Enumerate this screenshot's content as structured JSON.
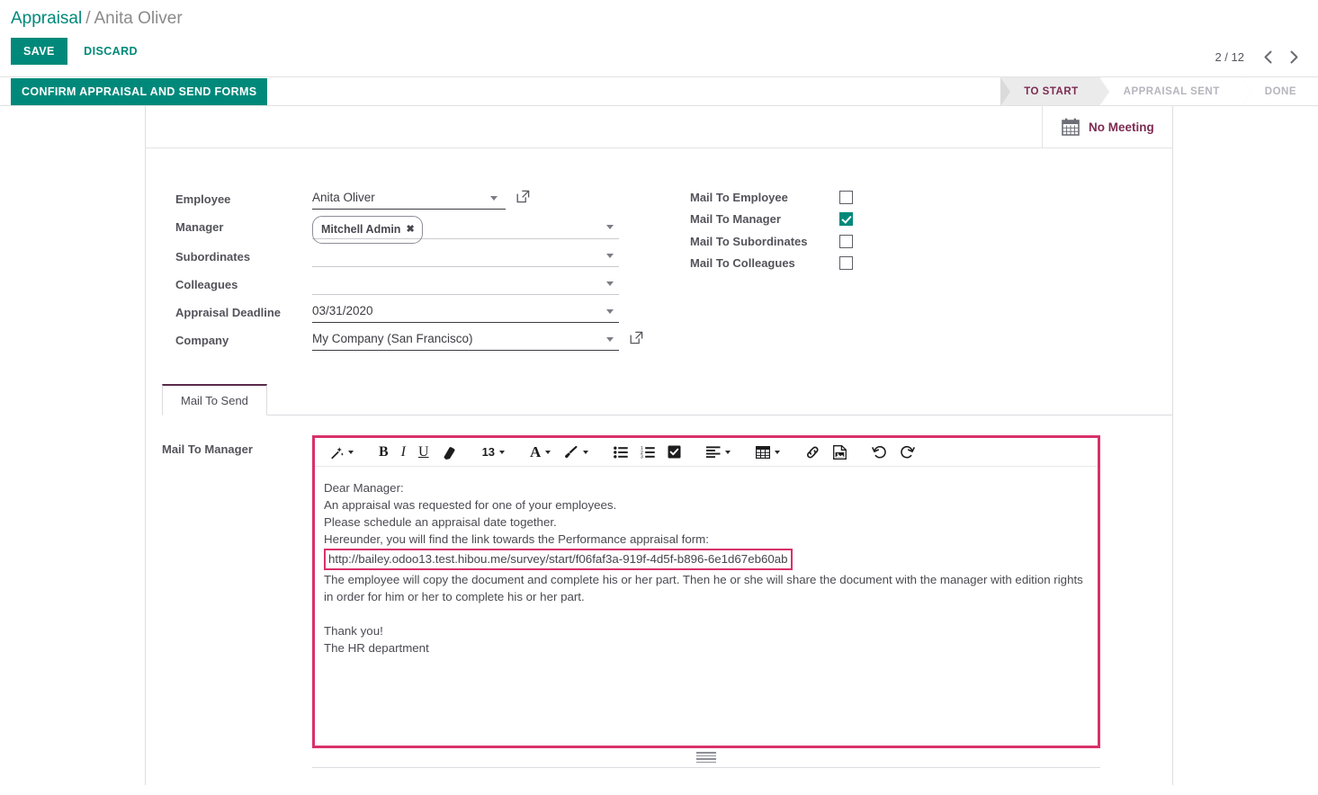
{
  "breadcrumb": {
    "root": "Appraisal",
    "separator": "/",
    "current": "Anita Oliver"
  },
  "actions": {
    "save_label": "SAVE",
    "discard_label": "DISCARD",
    "confirm_label": "CONFIRM APPRAISAL AND SEND FORMS"
  },
  "pager": {
    "count": "2 / 12",
    "prev_icon": "chevron-left-icon",
    "next_icon": "chevron-right-icon"
  },
  "statusbar": {
    "stages": [
      {
        "label": "TO START",
        "active": true
      },
      {
        "label": "APPRAISAL SENT",
        "active": false
      },
      {
        "label": "DONE",
        "active": false
      }
    ],
    "active_color": "#7c2b52",
    "inactive_color": "#b6b5bd"
  },
  "buttonbox": {
    "meeting_label": "No Meeting",
    "meeting_icon": "calendar-icon"
  },
  "form": {
    "fields": [
      {
        "label": "Employee",
        "value": "Anita Oliver",
        "type": "many2one",
        "has_extlink": true,
        "underline": "strong"
      },
      {
        "label": "Manager",
        "value": "",
        "type": "tags",
        "tags": [
          "Mitchell Admin"
        ],
        "has_extlink": false,
        "underline": "light"
      },
      {
        "label": "Subordinates",
        "value": "",
        "type": "tags",
        "tags": [],
        "has_extlink": false,
        "underline": "light"
      },
      {
        "label": "Colleagues",
        "value": "",
        "type": "tags",
        "tags": [],
        "has_extlink": false,
        "underline": "light"
      },
      {
        "label": "Appraisal Deadline",
        "value": "03/31/2020",
        "type": "date",
        "has_extlink": false,
        "underline": "strong"
      },
      {
        "label": "Company",
        "value": "My Company (San Francisco)",
        "type": "many2one",
        "has_extlink": true,
        "underline": "strong"
      }
    ],
    "checkboxes": [
      {
        "label": "Mail To Employee",
        "checked": false
      },
      {
        "label": "Mail To Manager",
        "checked": true
      },
      {
        "label": "Mail To Subordinates",
        "checked": false
      },
      {
        "label": "Mail To Colleagues",
        "checked": false
      }
    ],
    "checkbox_on_color": "#00897a"
  },
  "notebook": {
    "tabs": [
      {
        "label": "Mail To Send",
        "active": true
      }
    ]
  },
  "editor": {
    "field_label": "Mail To Manager",
    "highlight_color": "#d8326a",
    "toolbar": {
      "style_icon": "magic-wand-icon",
      "bold_label": "B",
      "italic_label": "I",
      "underline_label": "U",
      "eraser_icon": "eraser-icon",
      "font_size": "13",
      "font_color_label": "A",
      "background_color_icon": "paint-brush-icon",
      "unordered_list_icon": "bullet-list-icon",
      "ordered_list_icon": "numbered-list-icon",
      "checklist_icon": "checkbox-list-icon",
      "align_icon": "align-left-icon",
      "table_icon": "table-icon",
      "link_icon": "link-icon",
      "image_icon": "image-icon",
      "undo_icon": "undo-icon",
      "redo_icon": "redo-icon"
    },
    "body": {
      "line1": "Dear Manager:",
      "line2": "An appraisal was requested for one of your employees.",
      "line3": "Please schedule an appraisal date together.",
      "line4": "Hereunder, you will find the link towards the Performance appraisal form:",
      "link": "http://bailey.odoo13.test.hibou.me/survey/start/f06faf3a-919f-4d5f-b896-6e1d67eb60ab",
      "line5": "The employee will copy the document and complete his or her part. Then he or she will share the document with the manager with edition rights in order for him or her to complete his or her part.",
      "line6": "Thank you!",
      "line7": "The HR department"
    }
  }
}
